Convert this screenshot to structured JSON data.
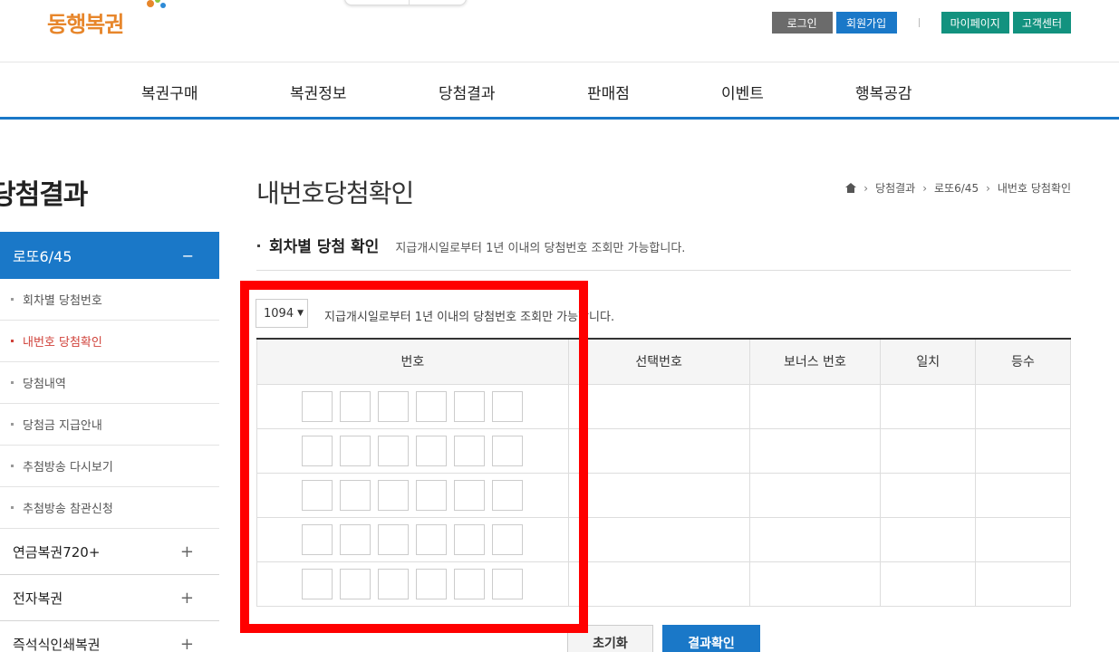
{
  "header": {
    "logo": "동행복권",
    "top_buttons": {
      "login": "로그인",
      "join": "회원가입",
      "mypage": "마이페이지",
      "support": "고객센터"
    },
    "gnb": [
      "복권구매",
      "복권정보",
      "당첨결과",
      "판매점",
      "이벤트",
      "행복공감"
    ]
  },
  "lnb": {
    "title": "당첨결과",
    "active_label": "로또6/45",
    "active_toggle": "−",
    "sub_items": [
      "회차별 당첨번호",
      "내번호 당첨확인",
      "당첨내역",
      "당첨금 지급안내",
      "추첨방송 다시보기",
      "추첨방송 참관신청"
    ],
    "selected_sub": "내번호 당첨확인",
    "main_items": [
      {
        "label": "연금복권720+",
        "toggle": "+"
      },
      {
        "label": "전자복권",
        "toggle": "+"
      },
      {
        "label": "즉석식인쇄복권",
        "toggle": "+"
      }
    ]
  },
  "content": {
    "page_title": "내번호당첨확인",
    "breadcrumb": [
      "당첨결과",
      "로또6/45",
      "내번호 당첨확인"
    ],
    "section_title": "회차별 당첨 확인",
    "section_desc": "지급개시일로부터 1년 이내의 당첨번호 조회만 가능합니다.",
    "round_select": "1094",
    "hint": "지급개시일로부터 1년 이내의 당첨번호 조회만 가능합니다.",
    "table_headers": [
      "번호",
      "선택번호",
      "보너스 번호",
      "일치",
      "등수"
    ],
    "reset_button": "초기화",
    "confirm_button": "결과확인"
  },
  "colors": {
    "accent": "#1a78c8",
    "teal": "#12927f",
    "highlight": "#ff0000",
    "active_sub": "#d0433b"
  }
}
